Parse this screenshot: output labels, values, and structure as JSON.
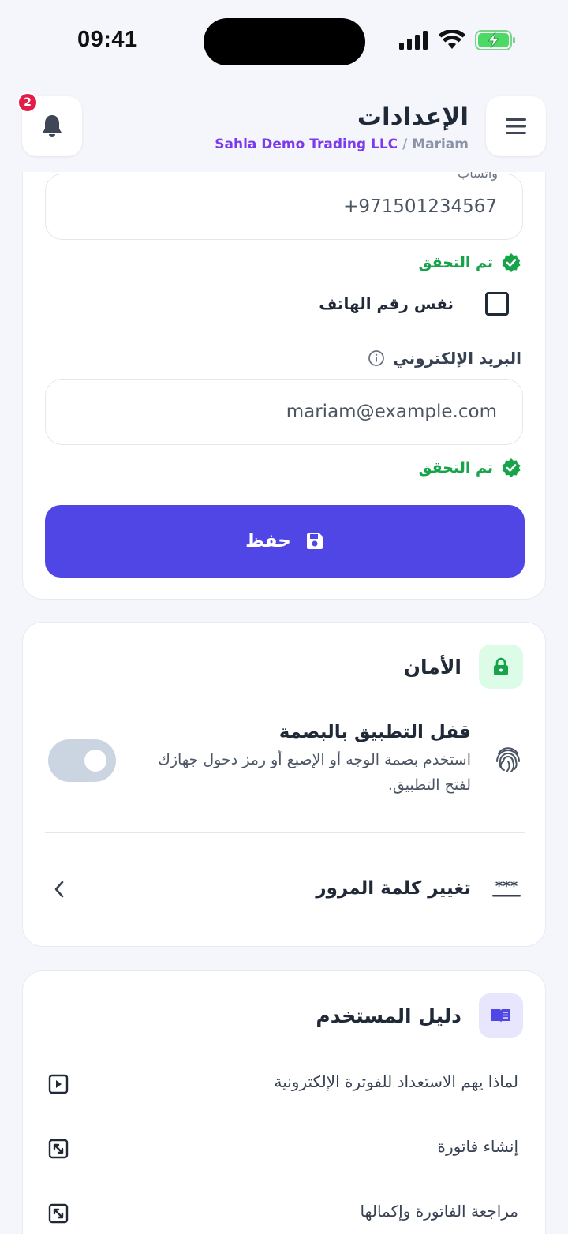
{
  "status_bar": {
    "time": "09:41"
  },
  "header": {
    "title": "الإعدادات",
    "company": "Sahla Demo Trading LLC",
    "separator": " / ",
    "user": "Mariam",
    "notification_count": "2"
  },
  "contact": {
    "whatsapp_label": "واتساب",
    "whatsapp_value": "+971501234567",
    "whatsapp_verified": "تم التحقق",
    "same_phone_label": "نفس رقم الهاتف",
    "email_label": "البريد الإلكتروني",
    "email_value": "mariam@example.com",
    "email_verified": "تم التحقق",
    "save_label": "حفظ"
  },
  "security": {
    "title": "الأمان",
    "biometric_title": "قفل التطبيق بالبصمة",
    "biometric_desc": "استخدم بصمة الوجه أو الإصبع أو رمز دخول جهازك لفتح التطبيق.",
    "change_password_label": "تغيير كلمة المرور",
    "password_icon_text": "***"
  },
  "guide": {
    "title": "دليل المستخدم",
    "items": [
      {
        "label": "لماذا يهم الاستعداد للفوترة الإلكترونية",
        "icon": "play-icon"
      },
      {
        "label": "إنشاء فاتورة",
        "icon": "external-link-icon"
      },
      {
        "label": "مراجعة الفاتورة وإكمالها",
        "icon": "external-link-icon"
      }
    ]
  },
  "colors": {
    "primary": "#4f46e5",
    "success": "#16a34a",
    "badge": "#e11d48",
    "company": "#7c3aed"
  }
}
